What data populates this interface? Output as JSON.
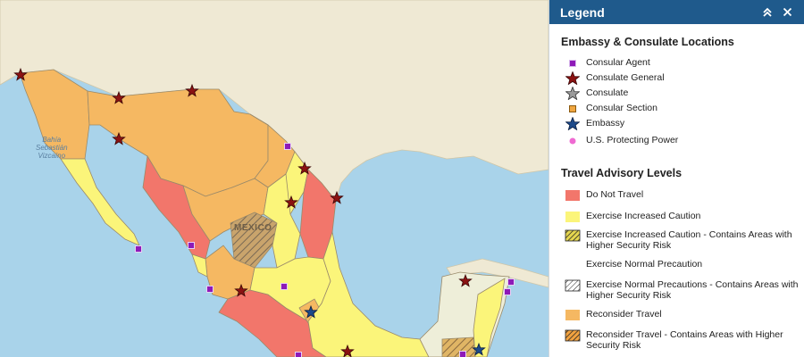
{
  "map": {
    "labels": {
      "mexico": "MEXICO",
      "bahia": [
        "Bahía",
        "Sebastián",
        "Vizcaíno"
      ]
    },
    "colors": {
      "water": "#a9d3ea",
      "land": "#efe9d4",
      "do_not_travel": "#f2766b",
      "exercise_increased_caution": "#fbf57a",
      "reconsider_travel": "#f5b862",
      "normal_precaution": "#eeeed9",
      "star_red": "#8b1212",
      "star_blue": "#1d4a8a",
      "square_purple": "#8e1ab8"
    }
  },
  "legend": {
    "title": "Legend",
    "collapse_icon": "double-chevron-up-icon",
    "close_icon": "close-icon",
    "locations_title": "Embassy & Consulate Locations",
    "locations": [
      {
        "label": "Consular Agent",
        "symbol": "purple-square",
        "color": "#8e1ab8"
      },
      {
        "label": "Consulate General",
        "symbol": "red-star",
        "color": "#8b1212"
      },
      {
        "label": "Consulate",
        "symbol": "gray-star",
        "color": "#9a9a9a"
      },
      {
        "label": "Consular Section",
        "symbol": "orange-square",
        "color": "#f0a640"
      },
      {
        "label": "Embassy",
        "symbol": "blue-star",
        "color": "#1d4a8a"
      },
      {
        "label": "U.S. Protecting Power",
        "symbol": "pink-dot",
        "color": "#ef6ad2"
      }
    ],
    "levels_title": "Travel Advisory Levels",
    "levels": [
      {
        "label": "Do Not Travel",
        "swatch": "solid",
        "color": "#f2766b"
      },
      {
        "label": "Exercise Increased Caution",
        "swatch": "solid",
        "color": "#fbf57a"
      },
      {
        "label": "Exercise Increased Caution - Contains Areas with Higher Security Risk",
        "swatch": "hatched",
        "color": "#e5d64f"
      },
      {
        "label": "Exercise Normal Precaution",
        "swatch": "none",
        "color": "#ffffff"
      },
      {
        "label": "Exercise Normal Precautions - Contains Areas with Higher Security Risk",
        "swatch": "hatched-white",
        "color": "#ffffff"
      },
      {
        "label": "Reconsider Travel",
        "swatch": "solid",
        "color": "#f5b862"
      },
      {
        "label": "Reconsider Travel - Contains Areas with Higher Security Risk",
        "swatch": "hatched",
        "color": "#f2a240"
      }
    ]
  }
}
